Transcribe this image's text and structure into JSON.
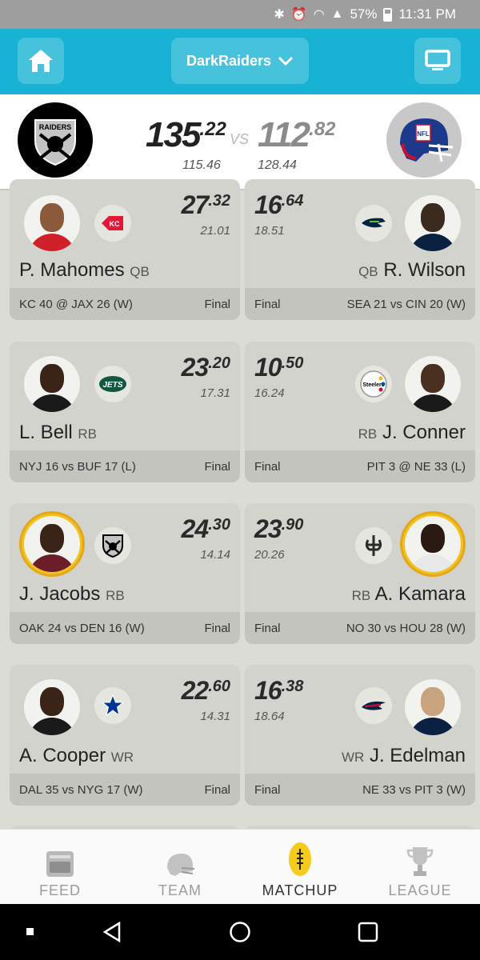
{
  "status_bar": {
    "battery": "57%",
    "time": "11:31 PM"
  },
  "header": {
    "team_name": "DarkRaiders"
  },
  "scoreboard": {
    "home_score_int": "135",
    "home_score_dec": ".22",
    "away_score_int": "112",
    "away_score_dec": ".82",
    "vs": "VS",
    "home_projected": "115.46",
    "away_projected": "128.44"
  },
  "matchups": [
    {
      "left": {
        "int": "27",
        "dec": ".32",
        "proj": "21.01",
        "name": "P. Mahomes",
        "pos": "QB",
        "game": "KC 40 @ JAX 26 (W)",
        "status": "Final"
      },
      "right": {
        "int": "16",
        "dec": ".64",
        "proj": "18.51",
        "name": "R. Wilson",
        "pos": "QB",
        "game": "SEA 21 vs CIN 20 (W)",
        "status": "Final"
      }
    },
    {
      "left": {
        "int": "23",
        "dec": ".20",
        "proj": "17.31",
        "name": "L. Bell",
        "pos": "RB",
        "game": "NYJ 16 vs BUF 17 (L)",
        "status": "Final"
      },
      "right": {
        "int": "10",
        "dec": ".50",
        "proj": "16.24",
        "name": "J. Conner",
        "pos": "RB",
        "game": "PIT 3 @ NE 33 (L)",
        "status": "Final"
      }
    },
    {
      "left": {
        "int": "24",
        "dec": ".30",
        "proj": "14.14",
        "name": "J. Jacobs",
        "pos": "RB",
        "game": "OAK 24 vs DEN 16 (W)",
        "status": "Final"
      },
      "right": {
        "int": "23",
        "dec": ".90",
        "proj": "20.26",
        "name": "A. Kamara",
        "pos": "RB",
        "game": "NO 30 vs HOU 28 (W)",
        "status": "Final"
      }
    },
    {
      "left": {
        "int": "22",
        "dec": ".60",
        "proj": "14.31",
        "name": "A. Cooper",
        "pos": "WR",
        "game": "DAL 35 vs NYG 17 (W)",
        "status": "Final"
      },
      "right": {
        "int": "16",
        "dec": ".38",
        "proj": "18.64",
        "name": "J. Edelman",
        "pos": "WR",
        "game": "NE 33 vs PIT 3 (W)",
        "status": "Final"
      }
    }
  ],
  "team_logo_text": {
    "raiders": "RAIDERS",
    "jets": "JETS",
    "steelers": "Steelers",
    "nfl": "NFL"
  },
  "bottom_nav": {
    "feed": "FEED",
    "team": "TEAM",
    "matchup": "MATCHUP",
    "league": "LEAGUE"
  },
  "colors": {
    "accent": "#18b3d4",
    "active_nav": "#f5cc1b"
  }
}
